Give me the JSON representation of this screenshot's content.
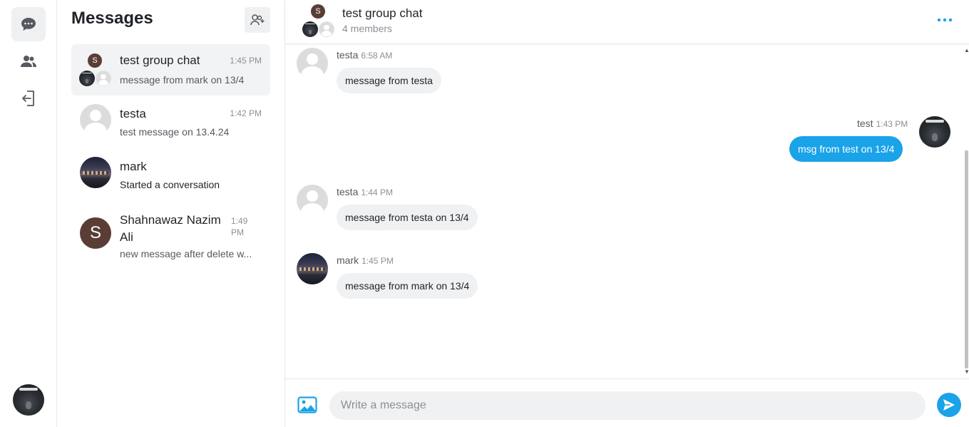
{
  "sidebar": {
    "icons": [
      "chat-bubble-icon",
      "users-icon",
      "logout-icon"
    ]
  },
  "conversations": {
    "title": "Messages",
    "items": [
      {
        "name": "test group chat",
        "time": "1:45 PM",
        "preview": "message from mark on 13/4",
        "avatar": "group"
      },
      {
        "name": "testa",
        "time": "1:42 PM",
        "preview": "test message on 13.4.24",
        "avatar": "ghost"
      },
      {
        "name": "mark",
        "time": "",
        "preview": "Started a conversation",
        "avatar": "city"
      },
      {
        "name": "Shahnawaz Nazim Ali",
        "time_line1": "1:49",
        "time_line2": "PM",
        "preview": "new message after delete w...",
        "avatar": "S"
      }
    ]
  },
  "chat": {
    "title": "test group chat",
    "subtitle": "4 members",
    "group_avatar_letter": "S",
    "messages": [
      {
        "sender": "testa",
        "time": "6:58 AM",
        "text": "message from testa",
        "mine": false,
        "avatar": "ghost"
      },
      {
        "sender": "test",
        "time": "1:43 PM",
        "text": "msg from test on 13/4",
        "mine": true,
        "avatar": "dark"
      },
      {
        "sender": "testa",
        "time": "1:44 PM",
        "text": "message from testa on 13/4",
        "mine": false,
        "avatar": "ghost"
      },
      {
        "sender": "mark",
        "time": "1:45 PM",
        "text": "message from mark on 13/4",
        "mine": false,
        "avatar": "city"
      }
    ],
    "composer": {
      "placeholder": "Write a message",
      "value": ""
    }
  },
  "colors": {
    "accent": "#1aa3e8",
    "active_bg": "#eef0f2",
    "bubble_bg": "#f0f1f3",
    "letter_avatar": "#5a3d34"
  }
}
